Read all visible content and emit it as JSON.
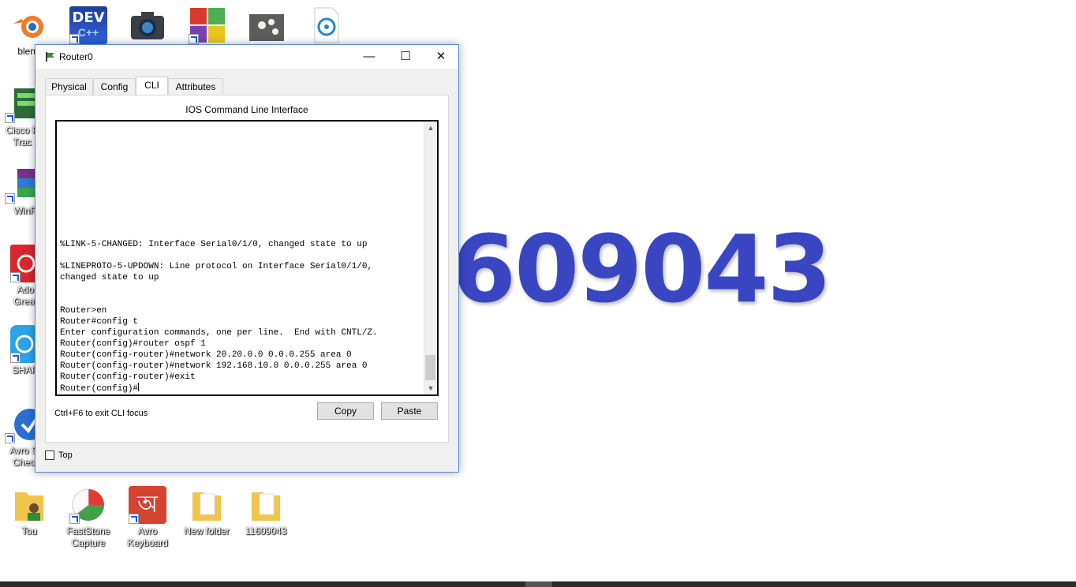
{
  "desktop": {
    "wallpaper_text": "609043",
    "icons": [
      {
        "label": "blend"
      },
      {
        "label": "DEV"
      },
      {
        "label": ""
      },
      {
        "label": ""
      },
      {
        "label": ""
      },
      {
        "label": ""
      },
      {
        "label": "Cisco P Trac"
      },
      {
        "label": "WinR"
      },
      {
        "label": "Ado Great"
      },
      {
        "label": "SHAR"
      },
      {
        "label": "Avro S Chec"
      },
      {
        "label": "Tou"
      },
      {
        "label": "FastStone Capture"
      },
      {
        "label": "Avro Keyboard"
      },
      {
        "label": "New folder"
      },
      {
        "label": "11609043"
      }
    ],
    "dev_icon_text": "DEV",
    "dev_icon_sub": "C++"
  },
  "window": {
    "title": "Router0",
    "controls": {
      "minimize": "—",
      "maximize": "☐",
      "close": "✕"
    },
    "tabs": [
      {
        "label": "Physical",
        "active": false
      },
      {
        "label": "Config",
        "active": false
      },
      {
        "label": "CLI",
        "active": true
      },
      {
        "label": "Attributes",
        "active": false
      }
    ],
    "cli": {
      "heading": "IOS Command Line Interface",
      "output": "%LINK-5-CHANGED: Interface Serial0/1/0, changed state to up\n\n%LINEPROTO-5-UPDOWN: Line protocol on Interface Serial0/1/0,\nchanged state to up\n\n\nRouter>en\nRouter#config t\nEnter configuration commands, one per line.  End with CNTL/Z.\nRouter(config)#router ospf 1\nRouter(config-router)#network 20.20.0.0 0.0.0.255 area 0\nRouter(config-router)#network 192.168.10.0 0.0.0.255 area 0\nRouter(config-router)#exit\nRouter(config)#",
      "hint": "Ctrl+F6 to exit CLI focus",
      "copy_label": "Copy",
      "paste_label": "Paste",
      "scroll_position": 0.95
    },
    "top_checkbox": {
      "label": "Top",
      "checked": false
    }
  },
  "colors": {
    "wallpaper_text": "#3a45c2",
    "window_border": "#5b8bd1"
  }
}
